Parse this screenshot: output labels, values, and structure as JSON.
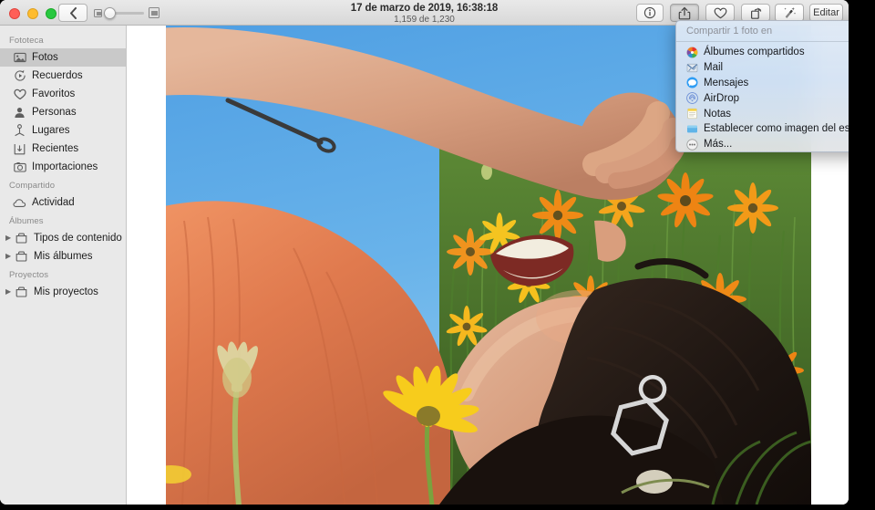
{
  "window": {
    "title": "17 de marzo de 2019, 16:38:18",
    "subtitle": "1,159 de 1,230"
  },
  "toolbar": {
    "back_icon": "chevron-left-icon",
    "zoom_slider": {
      "min_icon": "small-thumbnail-icon",
      "max_icon": "large-thumbnail-icon",
      "value": 0
    },
    "buttons": [
      {
        "name": "info-button",
        "icon": "info-circle-icon",
        "state": "normal"
      },
      {
        "name": "share-button",
        "icon": "share-icon",
        "state": "pressed"
      },
      {
        "name": "favorite-button",
        "icon": "heart-icon",
        "state": "normal"
      },
      {
        "name": "rotate-button",
        "icon": "rotate-icon",
        "state": "normal"
      },
      {
        "name": "enhance-button",
        "icon": "magic-wand-icon",
        "state": "active"
      }
    ],
    "edit_label": "Editar"
  },
  "sidebar": {
    "sections": [
      {
        "title": "Fototeca",
        "items": [
          {
            "label": "Fotos",
            "icon": "photo-frame-icon",
            "selected": true
          },
          {
            "label": "Recuerdos",
            "icon": "memories-icon",
            "selected": false
          },
          {
            "label": "Favoritos",
            "icon": "heart-icon",
            "selected": false
          },
          {
            "label": "Personas",
            "icon": "person-icon",
            "selected": false
          },
          {
            "label": "Lugares",
            "icon": "map-pin-icon",
            "selected": false
          },
          {
            "label": "Recientes",
            "icon": "download-box-icon",
            "selected": false
          },
          {
            "label": "Importaciones",
            "icon": "camera-icon",
            "selected": false
          }
        ]
      },
      {
        "title": "Compartido",
        "items": [
          {
            "label": "Actividad",
            "icon": "cloud-icon",
            "selected": false
          }
        ]
      },
      {
        "title": "Álbumes",
        "items": [
          {
            "label": "Tipos de contenido",
            "icon": "folder-icon",
            "selected": false,
            "disclosure": true
          },
          {
            "label": "Mis álbumes",
            "icon": "folder-icon",
            "selected": false,
            "disclosure": true
          }
        ]
      },
      {
        "title": "Proyectos",
        "items": [
          {
            "label": "Mis proyectos",
            "icon": "folder-icon",
            "selected": false,
            "disclosure": true
          }
        ]
      }
    ]
  },
  "share_menu": {
    "header": "Compartir 1 foto en",
    "items": [
      {
        "label": "Álbumes compartidos",
        "icon": "shared-albums-icon"
      },
      {
        "label": "Mail",
        "icon": "mail-icon"
      },
      {
        "label": "Mensajes",
        "icon": "messages-icon"
      },
      {
        "label": "AirDrop",
        "icon": "airdrop-icon"
      },
      {
        "label": "Notas",
        "icon": "notes-icon"
      },
      {
        "label": "Establecer como imagen del escritorio",
        "icon": "desktop-picture-icon"
      },
      {
        "label": "Más...",
        "icon": "more-ellipsis-icon"
      }
    ]
  },
  "photo": {
    "description": "Mujer con jersey naranja tumbada en un campo de flores con cielo azul",
    "sky_color": "#5fa9e8",
    "shirt_color": "#e07a4e",
    "flower_color": "#f3941f"
  }
}
